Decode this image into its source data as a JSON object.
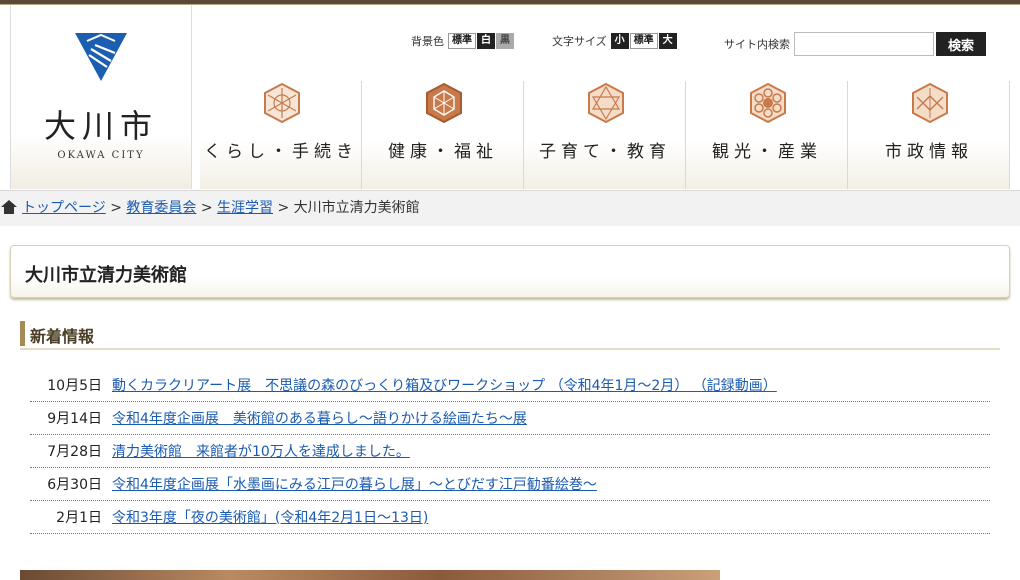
{
  "logo": {
    "title": "大川市",
    "subtitle": "OKAWA CITY"
  },
  "bg_color_tool": {
    "label": "背景色",
    "options": [
      "標準",
      "白",
      "黒"
    ]
  },
  "font_size_tool": {
    "label": "文字サイズ",
    "options": [
      "小",
      "標準",
      "大"
    ]
  },
  "site_search": {
    "label": "サイト内検索",
    "placeholder": "",
    "button": "検索"
  },
  "nav": [
    {
      "label": "くらし・手続き"
    },
    {
      "label": "健康・福祉"
    },
    {
      "label": "子育て・教育"
    },
    {
      "label": "観光・産業"
    },
    {
      "label": "市政情報"
    }
  ],
  "breadcrumb": {
    "items": [
      "トップページ",
      "教育委員会",
      "生涯学習"
    ],
    "separator": ">",
    "current": "大川市立清力美術館"
  },
  "page_title": "大川市立清力美術館",
  "news_section": {
    "heading": "新着情報",
    "items": [
      {
        "date": "10月5日",
        "title": "動くカラクリアート展　不思議の森のびっくり箱及びワークショップ （令和4年1月〜2月） （記録動画）"
      },
      {
        "date": "9月14日",
        "title": "令和4年度企画展　美術館のある暮らし〜語りかける絵画たち〜展"
      },
      {
        "date": "7月28日",
        "title": "清力美術館　来館者が10万人を達成しました。"
      },
      {
        "date": "6月30日",
        "title": "令和4年度企画展「水墨画にみる江戸の暮らし展」〜とびだす江戸勧番絵巻〜"
      },
      {
        "date": "2月1日",
        "title": "令和3年度「夜の美術館」(令和4年2月1日〜13日)"
      }
    ]
  },
  "colors": {
    "link": "#1a5bb0",
    "accent": "#a48a55",
    "brand_blue": "#1c5fb0",
    "emblem": "#c97a4a"
  }
}
